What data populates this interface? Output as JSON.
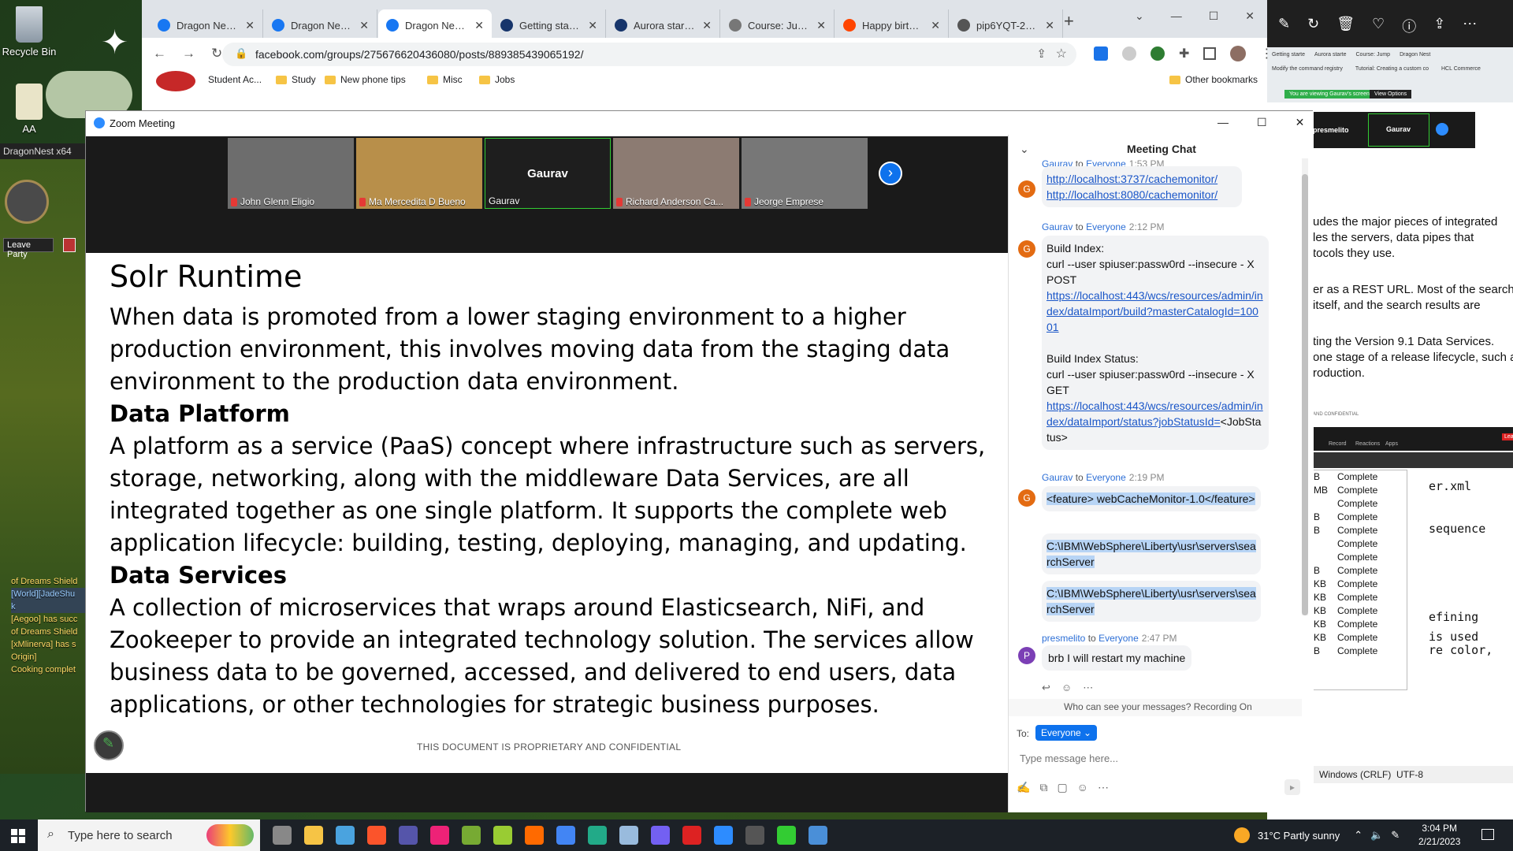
{
  "desktop": {
    "icons": [
      {
        "label": "Recycle Bin"
      },
      {
        "label": "AA"
      }
    ],
    "game": {
      "title": "DragonNest x64",
      "leave_party": "Leave Party",
      "chat_lines": [
        "of Dreams Shield",
        "[World][JadeShu",
        "k",
        "[Aegoo] has succ",
        "of Dreams Shield",
        "[xMlinerva] has s",
        "Origin]",
        "Cooking complet"
      ]
    }
  },
  "browser": {
    "tabs": [
      {
        "label": "Dragon Nest P",
        "color": "#1877f2"
      },
      {
        "label": "Dragon Nest S",
        "color": "#1877f2"
      },
      {
        "label": "Dragon Nest S",
        "color": "#1877f2",
        "active": true
      },
      {
        "label": "Getting started",
        "color": "#17356b"
      },
      {
        "label": "Aurora starter",
        "color": "#17356b"
      },
      {
        "label": "Course: Jump",
        "color": "#777777"
      },
      {
        "label": "Happy birthda",
        "color": "#ff4500"
      },
      {
        "label": "pip6YQT-2Ar5",
        "color": "#555555"
      }
    ],
    "new_tab": "+",
    "url": "facebook.com/groups/275676620436080/posts/889385439065192/",
    "bookmarks": [
      "Student Ac...",
      "Study",
      "New phone tips",
      "Misc",
      "Jobs"
    ],
    "other_bookmarks": "Other bookmarks"
  },
  "zoom": {
    "window_title": "Zoom Meeting",
    "participants": [
      {
        "name": "John Glenn Eligio",
        "muted": true
      },
      {
        "name": "Ma Mercedita D Bueno",
        "muted": true
      },
      {
        "name": "Gaurav",
        "muted": false,
        "video_off": true
      },
      {
        "name": "Richard Anderson Ca...",
        "muted": true
      },
      {
        "name": "Jeorge Emprese",
        "muted": true
      }
    ],
    "slide": {
      "title": "Solr Runtime",
      "intro": "When data is promoted from a lower staging environment to a higher production environment, this involves moving data from the staging data environment to the production data environment.",
      "section1_title": "Data Platform",
      "section1_body": "A platform as a service (PaaS) concept where infrastructure such as servers, storage, networking, along with the middleware Data Services, are all integrated together as one single platform. It supports the complete web application lifecycle: building, testing, deploying, managing, and updating.",
      "section2_title": "Data Services",
      "section2_body": "A collection of microservices that wraps around Elasticsearch, NiFi, and Zookeeper to provide an integrated technology solution. The services allow business data to be governed, accessed, and delivered to end users, data applications, or other technologies for strategic business purposes.",
      "footer": "THIS DOCUMENT IS PROPRIETARY AND CONFIDENTIAL"
    },
    "chat": {
      "title": "Meeting Chat",
      "m1": {
        "sender": "Gaurav",
        "to": "to",
        "recipient": "Everyone",
        "time": "1:53 PM",
        "link1": "http://localhost:3737/cachemonitor/",
        "link2": "http://localhost:8080/cachemonitor/"
      },
      "m2": {
        "sender": "Gaurav",
        "to": "to",
        "recipient": "Everyone",
        "time": "2:12 PM",
        "l1": "Build Index:",
        "l2": "curl --user spiuser:passw0rd --insecure - X POST",
        "link1": "https://localhost:443/wcs/resources/admin/index/dataImport/build?masterCatalogId=10001",
        "l3": "Build Index Status:",
        "l4": "curl --user spiuser:passw0rd --insecure - X GET",
        "link2": "https://localhost:443/wcs/resources/admin/index/dataImport/status?jobStatusId=",
        "tail": "<JobStatus>"
      },
      "m3": {
        "sender": "Gaurav",
        "to": "to",
        "recipient": "Everyone",
        "time": "2:19 PM",
        "b1": "<feature> webCacheMonitor-1.0</feature>",
        "b2": "C:\\IBM\\WebSphere\\Liberty\\usr\\servers\\searchServer",
        "b3": "C:\\IBM\\WebSphere\\Liberty\\usr\\servers\\searchServer"
      },
      "m4": {
        "sender": "presmelito",
        "to": "to",
        "recipient": "Everyone",
        "time": "2:47 PM",
        "text": "brb I will restart my machine"
      },
      "visibility_note": "Who can see your messages? Recording On",
      "to_label": "To:",
      "to_value": "Everyone",
      "input_placeholder": "Type message here..."
    }
  },
  "right_app": {
    "tabs": [
      "Getting starte",
      "Aurora starte",
      "Course: Jump",
      "Dragon Nest"
    ],
    "tabs2": [
      "Modify the command registry",
      "Tutorial: Creating a custom co",
      "HCL Commerce"
    ],
    "banner": "You are viewing Gaurav's screen",
    "view_options": "View Options",
    "mini_names": [
      "presmelito",
      "Gaurav"
    ],
    "text_lines": [
      "udes the major pieces of integrated",
      "les the servers, data pipes that",
      "tocols they use.",
      "er as a REST URL. Most of the search",
      "itself, and the search results are",
      "ting the Version 9.1 Data Services.",
      "one stage of a release lifecycle, such a",
      "roduction."
    ],
    "small_caption": "AND CONFIDENTIAL",
    "mini_toolbar": [
      "Record",
      "Reactions",
      "Apps"
    ],
    "leave": "Leave",
    "complete_rows": [
      "B",
      "MB",
      "",
      "B",
      "B",
      "",
      "",
      "B",
      "KB",
      "KB",
      "KB",
      "KB",
      "KB",
      "B"
    ],
    "complete_label": "Complete",
    "code_lines": [
      "er.xml",
      "sequence",
      "efining",
      "is used",
      "re color,"
    ],
    "status_encoding": "Windows (CRLF)",
    "status_charset": "UTF-8"
  },
  "taskbar": {
    "search_placeholder": "Type here to search",
    "weather": "31°C  Partly sunny",
    "time": "3:04 PM",
    "date": "2/21/2023"
  }
}
